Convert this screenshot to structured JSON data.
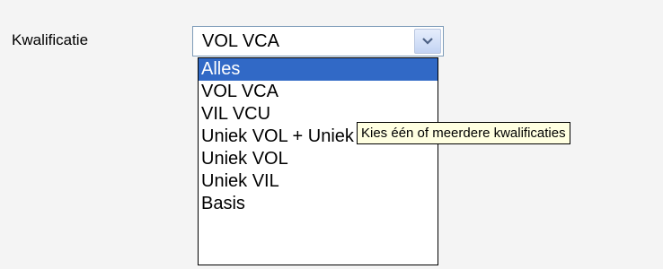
{
  "field": {
    "label": "Kwalificatie"
  },
  "select": {
    "value": "VOL VCA",
    "options": [
      {
        "label": "Alles",
        "highlighted": true
      },
      {
        "label": "VOL VCA",
        "highlighted": false
      },
      {
        "label": "VIL VCU",
        "highlighted": false
      },
      {
        "label": "Uniek VOL + Uniek VIL",
        "highlighted": false
      },
      {
        "label": "Uniek VOL",
        "highlighted": false
      },
      {
        "label": "Uniek VIL",
        "highlighted": false
      },
      {
        "label": "Basis",
        "highlighted": false
      }
    ]
  },
  "tooltip": {
    "text": "Kies één of meerdere kwalificaties"
  },
  "colors": {
    "highlight": "#3169c6",
    "tooltip_bg": "#ffffe1",
    "page_bg": "#f4f4f4"
  },
  "icons": {
    "dropdown_arrow": "chevron-down-icon"
  }
}
